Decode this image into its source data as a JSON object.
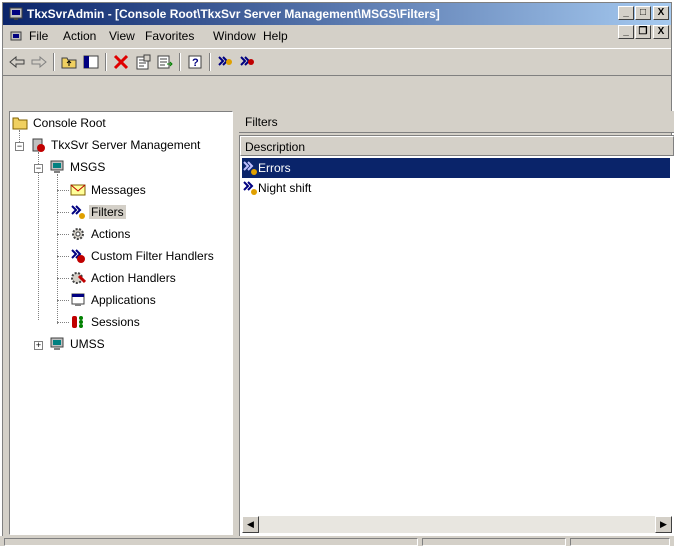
{
  "window": {
    "title": "TkxSvrAdmin - [Console Root\\TkxSvr Server Management\\MSGS\\Filters]"
  },
  "window_controls": {
    "minimize": "_",
    "maximize": "□",
    "close": "X"
  },
  "menubar": {
    "items": [
      {
        "label": "File"
      },
      {
        "label": "Action"
      },
      {
        "label": "View"
      },
      {
        "label": "Favorites"
      },
      {
        "label": "Window"
      },
      {
        "label": "Help"
      }
    ]
  },
  "mdi_controls": {
    "minimize": "_",
    "restore": "❐",
    "close": "X"
  },
  "toolbar": {
    "icons": [
      "back-icon",
      "forward-icon",
      "up-folder-icon",
      "show-hide-tree-icon",
      "delete-icon",
      "properties-icon",
      "export-list-icon",
      "help-icon",
      "filter-icon",
      "filter-alt-icon"
    ]
  },
  "tree": {
    "nodes": [
      {
        "label": "Console Root",
        "icon": "folder-icon"
      },
      {
        "label": "TkxSvr Server Management",
        "icon": "server-icon"
      },
      {
        "label": "MSGS",
        "icon": "computer-icon"
      },
      {
        "label": "Messages",
        "icon": "envelope-icon"
      },
      {
        "label": "Filters",
        "icon": "filter-icon",
        "selected": true
      },
      {
        "label": "Actions",
        "icon": "gear-icon"
      },
      {
        "label": "Custom Filter Handlers",
        "icon": "custom-filter-icon"
      },
      {
        "label": "Action Handlers",
        "icon": "action-handler-icon"
      },
      {
        "label": "Applications",
        "icon": "application-icon"
      },
      {
        "label": "Sessions",
        "icon": "sessions-icon"
      },
      {
        "label": "UMSS",
        "icon": "computer-icon"
      }
    ]
  },
  "right_panel": {
    "header": "Filters",
    "columns": [
      {
        "label": "Description"
      }
    ],
    "rows": [
      {
        "label": "Errors",
        "selected": true
      },
      {
        "label": "Night shift"
      }
    ]
  },
  "scrollbar": {
    "left": "◀",
    "right": "▶"
  },
  "colors": {
    "title_start": "#0a246a",
    "title_end": "#a6caf0",
    "selection": "#0a246a",
    "chrome": "#d4d0c8"
  }
}
